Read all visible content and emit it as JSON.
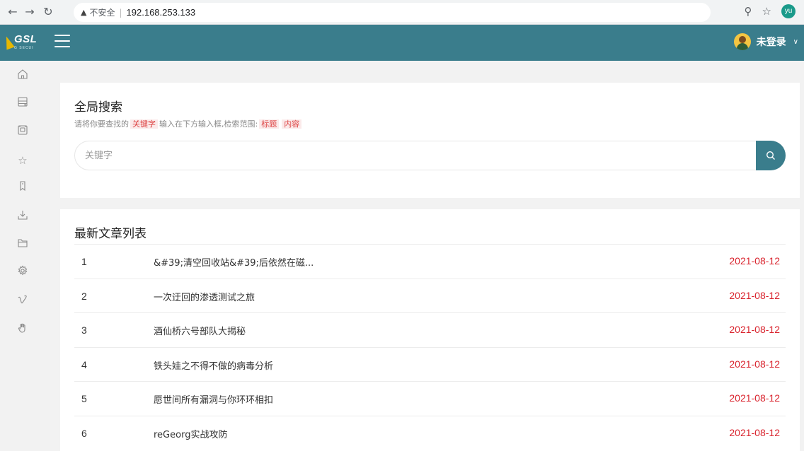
{
  "browser": {
    "security_label": "不安全",
    "url": "192.168.253.133",
    "profile_initials": "yu"
  },
  "header": {
    "logo_text": "GSL",
    "logo_sub": "G SECUI",
    "user_label": "未登录"
  },
  "sidebar": {
    "items": [
      {
        "icon": "home-icon"
      },
      {
        "icon": "server-icon"
      },
      {
        "icon": "inbox-icon"
      },
      {
        "icon": "star-icon"
      },
      {
        "icon": "bookmark-icon"
      },
      {
        "icon": "download-icon"
      },
      {
        "icon": "folder-icon"
      },
      {
        "icon": "settings-icon"
      },
      {
        "icon": "vimeo-icon"
      },
      {
        "icon": "hand-icon"
      }
    ]
  },
  "search": {
    "title": "全局搜索",
    "hint_prefix": "请将你要查找的",
    "hint_keyword": "关键字",
    "hint_middle": "输入在下方输入框,检索范围:",
    "hint_scope_1": "标题",
    "hint_scope_2": "内容",
    "placeholder": "关键字"
  },
  "articles": {
    "title": "最新文章列表",
    "rows": [
      {
        "num": "1",
        "title": "&#39;清空回收站&#39;后依然在磁...",
        "date": "2021-08-12"
      },
      {
        "num": "2",
        "title": "一次迂回的渗透测试之旅",
        "date": "2021-08-12"
      },
      {
        "num": "3",
        "title": "酒仙桥六号部队大揭秘",
        "date": "2021-08-12"
      },
      {
        "num": "4",
        "title": "铁头娃之不得不做的病毒分析",
        "date": "2021-08-12"
      },
      {
        "num": "5",
        "title": "愿世间所有漏洞与你环环相扣",
        "date": "2021-08-12"
      },
      {
        "num": "6",
        "title": "reGeorg实战攻防",
        "date": "2021-08-12"
      }
    ]
  },
  "colors": {
    "header_bg": "#3a7d8c",
    "date_red": "#d9232d",
    "tag_red": "#dd4444"
  }
}
